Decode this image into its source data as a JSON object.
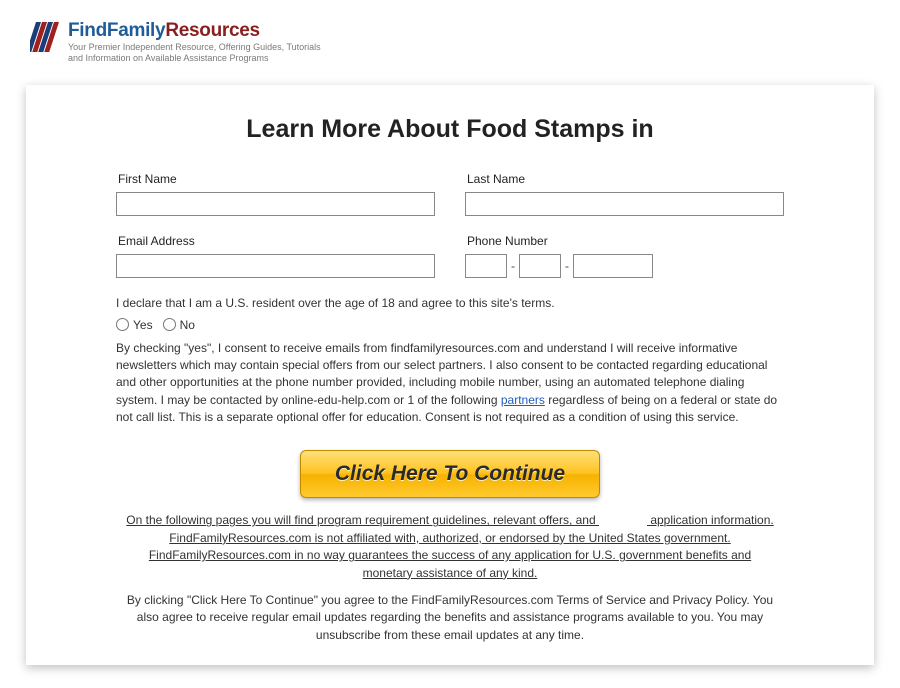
{
  "brand": {
    "find": "Find",
    "family": "Family",
    "resources": "Resources",
    "tagline": "Your Premier Independent Resource, Offering Guides, Tutorials and Information on Available Assistance Programs"
  },
  "page": {
    "title": "Learn More About Food Stamps in"
  },
  "form": {
    "first_name_label": "First Name",
    "last_name_label": "Last Name",
    "email_label": "Email Address",
    "phone_label": "Phone Number",
    "phone_sep": "-",
    "declare_text": "I declare that I am a U.S. resident over the age of 18 and agree to this site's terms.",
    "yes_label": "Yes",
    "no_label": "No",
    "consent_part1": "By checking \"yes\", I consent to receive emails from findfamilyresources.com and understand I will receive informative newsletters which may contain special offers from our select partners. I also consent to be contacted regarding educational and other opportunities at the phone number provided, including mobile number, using an automated telephone dialing system. I may be contacted by online-edu-help.com or 1 of the following ",
    "partners_link": "partners",
    "consent_part2": " regardless of being on a federal or state do not call list. This is a separate optional offer for education. Consent is not required as a condition of using this service.",
    "cta_label": "Click Here To Continue"
  },
  "footer": {
    "disclaimer_a": "On the following pages you will find program requirement guidelines, relevant offers, and ",
    "disclaimer_b": " application information. FindFamilyResources.com is not affiliated with, authorized, or endorsed by the United States government. FindFamilyResources.com in no way guarantees the success of any application for U.S. government benefits and monetary assistance of any kind.",
    "terms": "By clicking \"Click Here To Continue\" you agree to the FindFamilyResources.com Terms of Service and Privacy Policy. You also agree to receive regular email updates regarding the benefits and assistance programs available to you. You may unsubscribe from these email updates at any time."
  }
}
